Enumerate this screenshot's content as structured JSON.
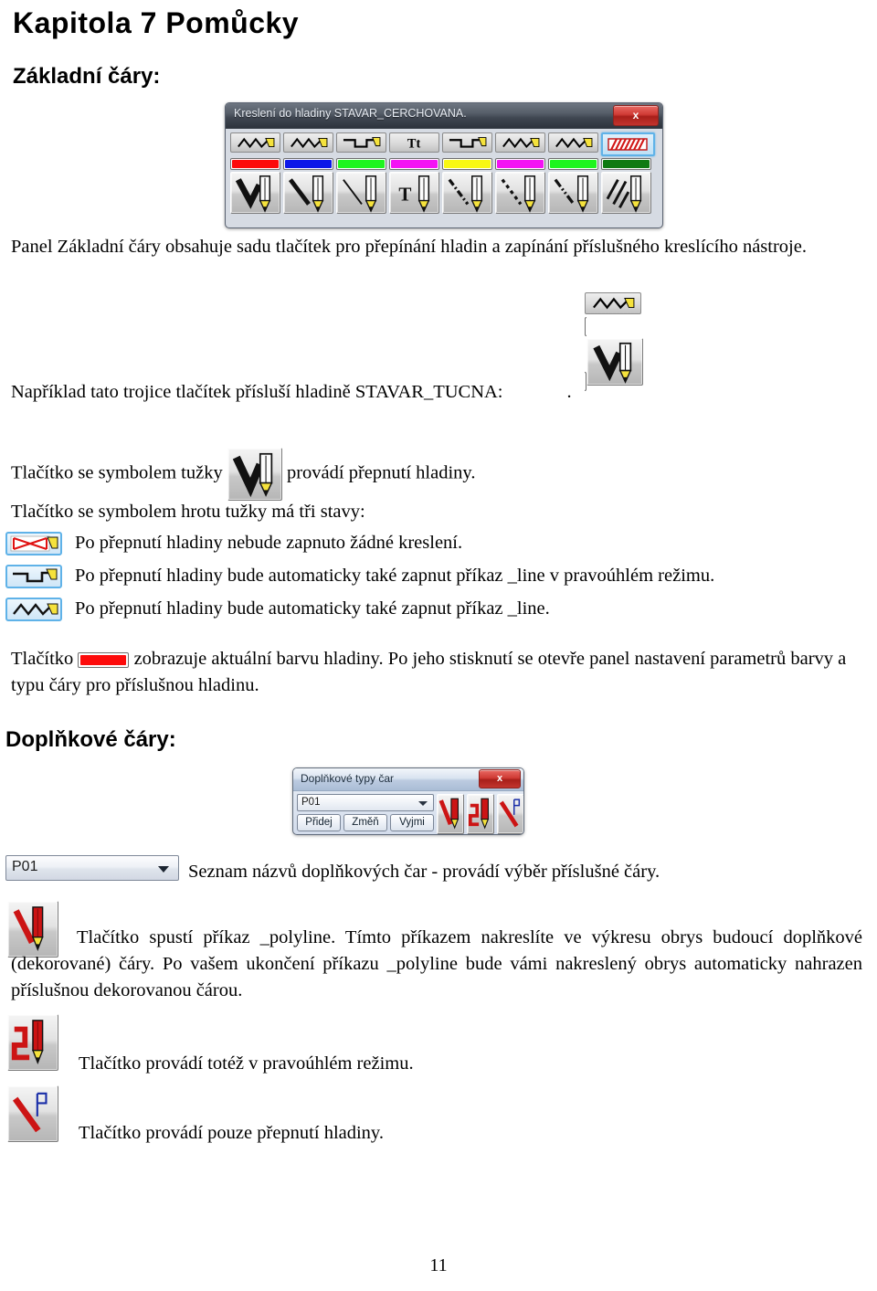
{
  "document": {
    "chapter_title": "Kapitola 7  Pomůcky",
    "page_number": "11"
  },
  "sections": {
    "basic_lines_heading": "Základní čáry:",
    "extra_lines_heading": "Doplňkové čáry:"
  },
  "paragraphs": {
    "panel_description": "Panel Základní čáry obsahuje sadu tlačítek pro přepínání hladin a zapínání příslušného kreslícího nástroje.",
    "example_trio": "Například tato trojice tlačítek přísluší hladině STAVAR_TUCNA:",
    "example_trio_tail": ".",
    "pencil_button_pre": "Tlačítko se symbolem tužky",
    "pencil_button_post": "provádí přepnutí hladiny.",
    "three_states_intro": "Tlačítko se symbolem hrotu tužky má tři stavy:",
    "state_none": "Po přepnutí hladiny nebude zapnuto žádné kreslení.",
    "state_ortho": "Po přepnutí hladiny bude automaticky také zapnut příkaz _line v pravoúhlém režimu.",
    "state_line": "Po přepnutí hladiny bude automaticky také zapnut příkaz _line.",
    "color_button_pre": "Tlačítko",
    "color_button_post": "zobrazuje aktuální barvu hladiny. Po jeho stisknutí se otevře panel nastavení parametrů barvy a typu čáry pro příslušnou hladinu.",
    "combo_description": "Seznam názvů doplňkových čar - provádí výběr příslušné čáry.",
    "polyline_description": "Tlačítko spustí příkaz _polyline. Tímto příkazem nakreslíte ve výkresu obrys budoucí doplňkové (dekorované) čáry. Po vašem ukončení příkazu _polyline bude vámi nakreslený obrys automaticky nahrazen příslušnou dekorovanou čárou.",
    "ortho_description": "Tlačítko provádí totéž v pravoúhlém režimu.",
    "layer_only_description": "Tlačítko provádí pouze přepnutí hladiny."
  },
  "dialog_basic_lines": {
    "title": "Kreslení do hladiny STAVAR_CERCHOVANA.",
    "close_label": "x",
    "columns": [
      {
        "line_icon": "zigzag-line-icon",
        "selected": false,
        "color": "#fd0b0b",
        "pencil_icon": "pencil-thick-line-icon"
      },
      {
        "line_icon": "zigzag-line-icon",
        "selected": false,
        "color": "#0d18e8",
        "pencil_icon": "pencil-medium-line-icon"
      },
      {
        "line_icon": "ortho-line-icon",
        "selected": false,
        "color": "#1ef51e",
        "pencil_icon": "pencil-thin-line-icon"
      },
      {
        "line_icon": "text-icon",
        "selected": false,
        "color": "#f412f4",
        "pencil_icon": "pencil-text-icon",
        "label": "Tt"
      },
      {
        "line_icon": "ortho-line-icon",
        "selected": false,
        "color": "#f8f813",
        "pencil_icon": "pencil-dashdot-line-icon"
      },
      {
        "line_icon": "zigzag-line-icon",
        "selected": false,
        "color": "#f412f4",
        "pencil_icon": "pencil-dashed-line-icon"
      },
      {
        "line_icon": "zigzag-line-icon",
        "selected": false,
        "color": "#1ef51e",
        "pencil_icon": "pencil-dashdotdot-line-icon"
      },
      {
        "line_icon": "hatch-icon",
        "selected": true,
        "color": "#0f7a12",
        "pencil_icon": "pencil-hatch-icon"
      }
    ]
  },
  "dialog_extra_lines": {
    "title": "Doplňkové typy čar",
    "close_label": "x",
    "combo_value": "P01",
    "buttons": [
      {
        "label": "Přidej"
      },
      {
        "label": "Změň"
      },
      {
        "label": "Vyjmi"
      }
    ],
    "icons": [
      {
        "name": "red-pencil-polyline-icon"
      },
      {
        "name": "red-pencil-ortho-icon"
      },
      {
        "name": "red-line-layer-icon"
      }
    ]
  },
  "combo_standalone": {
    "value": "P01"
  },
  "trio_example": {
    "line_icon": "zigzag-line-icon",
    "color": "#fd0b0b",
    "pencil_icon": "pencil-thick-line-icon"
  },
  "colors": {
    "close_red": "#c2342e",
    "selection_blue": "#5fb2e8",
    "swatch_red": "#fd0b0b"
  }
}
